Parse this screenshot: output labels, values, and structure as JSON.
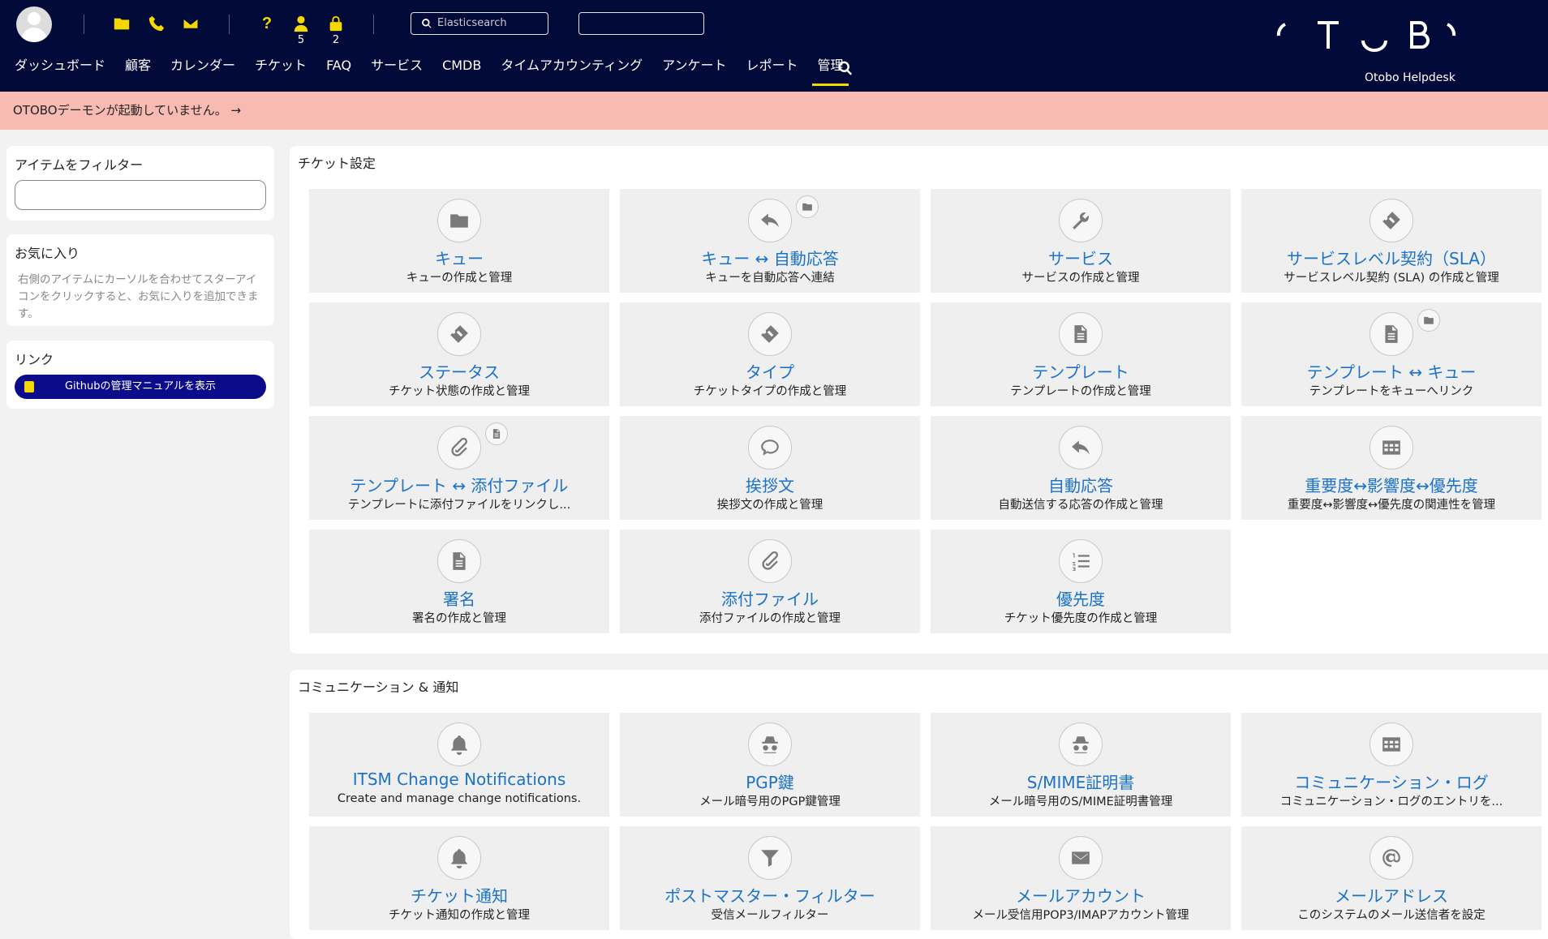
{
  "header": {
    "counts": {
      "user": "5",
      "lock": "2"
    },
    "search_placeholder": "Elasticsearch",
    "brand": "Otobo Helpdesk",
    "logo_letters": [
      "(",
      "T",
      "‿",
      "B",
      ")"
    ],
    "nav": [
      "ダッシュボード",
      "顧客",
      "カレンダー",
      "チケット",
      "FAQ",
      "サービス",
      "CMDB",
      "タイムアカウンティング",
      "アンケート",
      "レポート",
      "管理"
    ],
    "active_nav": "管理"
  },
  "banner": {
    "text": "OTOBOデーモンが起動していません。 →"
  },
  "sidebar": {
    "filter_title": "アイテムをフィルター",
    "fav_title": "お気に入り",
    "fav_text": "右側のアイテムにカーソルを合わせてスターアイコンをクリックすると、お気に入りを追加できます。",
    "links_title": "リンク",
    "github_button": "Githubの管理マニュアルを表示"
  },
  "sections": [
    {
      "title": "チケット設定",
      "tiles": [
        {
          "title": "キュー",
          "desc": "キューの作成と管理",
          "icon": "folder-icon"
        },
        {
          "title": "キュー ↔ 自動応答",
          "desc": "キューを自動応答へ連結",
          "icon": "reply-icon",
          "mini": "folder-icon"
        },
        {
          "title": "サービス",
          "desc": "サービスの作成と管理",
          "icon": "wrench-icon"
        },
        {
          "title": "サービスレベル契約（SLA）",
          "desc": "サービスレベル契約 (SLA) の作成と管理",
          "icon": "ticket-icon"
        },
        {
          "title": "ステータス",
          "desc": "チケット状態の作成と管理",
          "icon": "ticket-icon"
        },
        {
          "title": "タイプ",
          "desc": "チケットタイプの作成と管理",
          "icon": "ticket-icon"
        },
        {
          "title": "テンプレート",
          "desc": "テンプレートの作成と管理",
          "icon": "document-icon"
        },
        {
          "title": "テンプレート ↔ キュー",
          "desc": "テンプレートをキューへリンク",
          "icon": "document-icon",
          "mini": "folder-icon"
        },
        {
          "title": "テンプレート ↔ 添付ファイル",
          "desc": "テンプレートに添付ファイルをリンクし...",
          "icon": "paperclip-icon",
          "mini": "document-icon"
        },
        {
          "title": "挨拶文",
          "desc": "挨拶文の作成と管理",
          "icon": "speech-bubble-icon"
        },
        {
          "title": "自動応答",
          "desc": "自動送信する応答の作成と管理",
          "icon": "reply-icon"
        },
        {
          "title": "重要度↔影響度↔優先度",
          "desc": "重要度↔影響度↔優先度の関連性を管理",
          "icon": "table-icon"
        },
        {
          "title": "署名",
          "desc": "署名の作成と管理",
          "icon": "document-icon"
        },
        {
          "title": "添付ファイル",
          "desc": "添付ファイルの作成と管理",
          "icon": "paperclip-icon"
        },
        {
          "title": "優先度",
          "desc": "チケット優先度の作成と管理",
          "icon": "numbered-list-icon"
        }
      ]
    },
    {
      "title": "コミュニケーション & 通知",
      "tiles": [
        {
          "title": "ITSM Change Notifications",
          "desc": "Create and manage change notifications.",
          "icon": "bell-icon"
        },
        {
          "title": "PGP鍵",
          "desc": "メール暗号用のPGP鍵管理",
          "icon": "spy-icon"
        },
        {
          "title": "S/MIME証明書",
          "desc": "メール暗号用のS/MIME証明書管理",
          "icon": "spy-icon"
        },
        {
          "title": "コミュニケーション・ログ",
          "desc": "コミュニケーション・ログのエントリを...",
          "icon": "table-icon"
        },
        {
          "title": "チケット通知",
          "desc": "チケット通知の作成と管理",
          "icon": "bell-icon"
        },
        {
          "title": "ポストマスター・フィルター",
          "desc": "受信メールフィルター",
          "icon": "filter-icon"
        },
        {
          "title": "メールアカウント",
          "desc": "メール受信用POP3/IMAPアカウント管理",
          "icon": "envelope-icon"
        },
        {
          "title": "メールアドレス",
          "desc": "このシステムのメール送信者を設定",
          "icon": "at-icon"
        }
      ]
    }
  ]
}
